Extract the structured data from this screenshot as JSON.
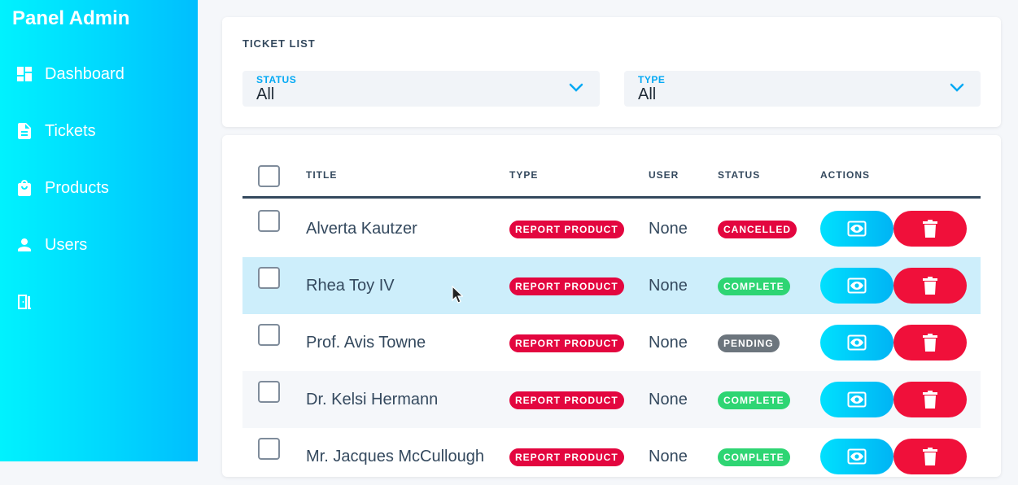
{
  "sidebar": {
    "brand": "Panel Admin",
    "items": [
      {
        "label": "Dashboard",
        "icon": "dashboard-icon"
      },
      {
        "label": "Tickets",
        "icon": "document-icon"
      },
      {
        "label": "Products",
        "icon": "shopping-bag-icon"
      },
      {
        "label": "Users",
        "icon": "user-icon"
      },
      {
        "label": "",
        "icon": "logout-door-icon"
      }
    ]
  },
  "filters": {
    "title": "TICKET LIST",
    "status": {
      "label": "STATUS",
      "value": "All"
    },
    "type": {
      "label": "TYPE",
      "value": "All"
    }
  },
  "table": {
    "headers": {
      "title": "TITLE",
      "type": "TYPE",
      "user": "USER",
      "status": "STATUS",
      "actions": "ACTIONS"
    },
    "rows": [
      {
        "title": "Alverta Kautzer",
        "type": "REPORT PRODUCT",
        "user": "None",
        "status": "CANCELLED"
      },
      {
        "title": "Rhea Toy IV",
        "type": "REPORT PRODUCT",
        "user": "None",
        "status": "COMPLETE"
      },
      {
        "title": "Prof. Avis Towne",
        "type": "REPORT PRODUCT",
        "user": "None",
        "status": "PENDING"
      },
      {
        "title": "Dr. Kelsi Hermann",
        "type": "REPORT PRODUCT",
        "user": "None",
        "status": "COMPLETE"
      },
      {
        "title": "Mr. Jacques McCullough",
        "type": "REPORT PRODUCT",
        "user": "None",
        "status": "COMPLETE"
      }
    ]
  },
  "colors": {
    "type_badge": "#e3063f",
    "cancelled": "#e3063f",
    "complete": "#2ed573",
    "pending": "#6c757d",
    "view_button": "#00c8f8",
    "delete_button": "#f0103a"
  }
}
